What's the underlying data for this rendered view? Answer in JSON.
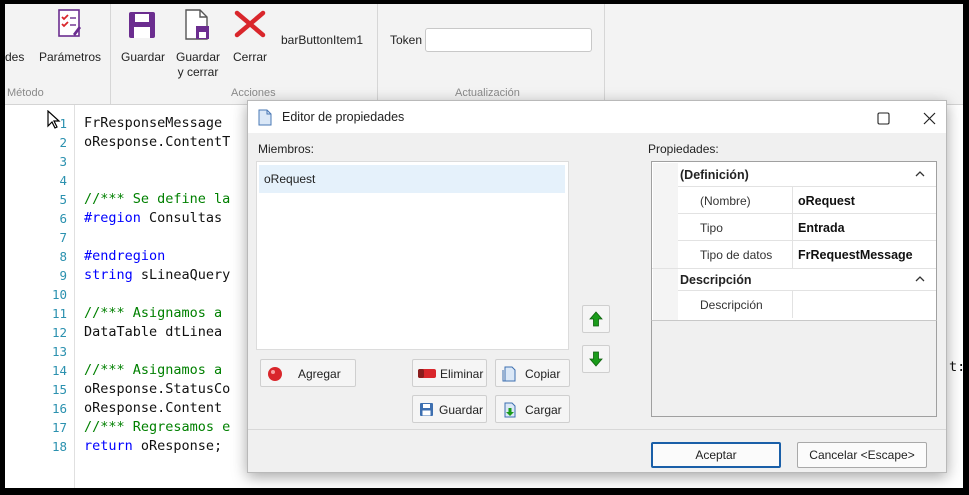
{
  "ribbon": {
    "metodo_group": {
      "partial_label": "des",
      "parametros_label": "Parámetros",
      "group_label": "Método"
    },
    "acciones_group": {
      "guardar_label": "Guardar",
      "guardar_cerrar_line1": "Guardar",
      "guardar_cerrar_line2": "y cerrar",
      "cerrar_label": "Cerrar",
      "bar_button_label": "barButtonItem1",
      "group_label": "Acciones"
    },
    "actualizacion_group": {
      "token_label": "Token",
      "token_value": "",
      "group_label": "Actualización"
    }
  },
  "editor": {
    "lines": [
      {
        "n": "1",
        "text": "FrResponseMessage",
        "style": "plain"
      },
      {
        "n": "2",
        "text": "oResponse.ContentT",
        "style": "plain"
      },
      {
        "n": "3",
        "text": "",
        "style": "plain"
      },
      {
        "n": "4",
        "text": "",
        "style": "plain"
      },
      {
        "n": "5",
        "text": "//*** Se define la",
        "style": "comment"
      },
      {
        "n": "6",
        "text_kw": "#region",
        "text_rest": " Consultas",
        "style": "kw"
      },
      {
        "n": "7",
        "text": "",
        "style": "plain"
      },
      {
        "n": "8",
        "text_kw": "#endregion",
        "text_rest": "",
        "style": "kw"
      },
      {
        "n": "9",
        "text_kw": "string",
        "text_rest": " sLineaQuery",
        "style": "kw"
      },
      {
        "n": "10",
        "text": "",
        "style": "plain"
      },
      {
        "n": "11",
        "text": "//*** Asignamos a",
        "style": "comment"
      },
      {
        "n": "12",
        "text": "DataTable dtLinea",
        "style": "plain"
      },
      {
        "n": "13",
        "text": "",
        "style": "plain"
      },
      {
        "n": "14",
        "text": "//*** Asignamos a",
        "style": "comment"
      },
      {
        "n": "15",
        "text": "oResponse.StatusCo",
        "style": "plain"
      },
      {
        "n": "16",
        "text": "oResponse.Content",
        "style": "plain"
      },
      {
        "n": "17",
        "text": "//*** Regresamos e",
        "style": "comment"
      },
      {
        "n": "18",
        "text_kw": "return",
        "text_rest": " oResponse;",
        "style": "kw"
      }
    ],
    "right_fragment": "t:"
  },
  "dialog": {
    "title": "Editor de propiedades",
    "members_label": "Miembros:",
    "properties_label": "Propiedades:",
    "members": [
      "oRequest"
    ],
    "buttons": {
      "agregar": "Agregar",
      "eliminar": "Eliminar",
      "copiar": "Copiar",
      "guardar": "Guardar",
      "cargar": "Cargar"
    },
    "properties": {
      "cat1": "(Definición)",
      "rows1": [
        {
          "name": "(Nombre)",
          "value": "oRequest"
        },
        {
          "name": "Tipo",
          "value": "Entrada"
        },
        {
          "name": "Tipo de datos",
          "value": "FrRequestMessage"
        }
      ],
      "cat2": "Descripción",
      "rows2": [
        {
          "name": "Descripción",
          "value": ""
        }
      ]
    },
    "footer": {
      "accept": "Aceptar",
      "cancel": "Cancelar <Escape>"
    }
  },
  "colors": {
    "accent_red": "#d9262b",
    "accent_purple": "#6b2d8f",
    "up_arrow_green": "#1a9b1a",
    "comment_green": "#008000",
    "keyword_blue": "#0000ff",
    "line_number_teal": "#2b91af"
  }
}
